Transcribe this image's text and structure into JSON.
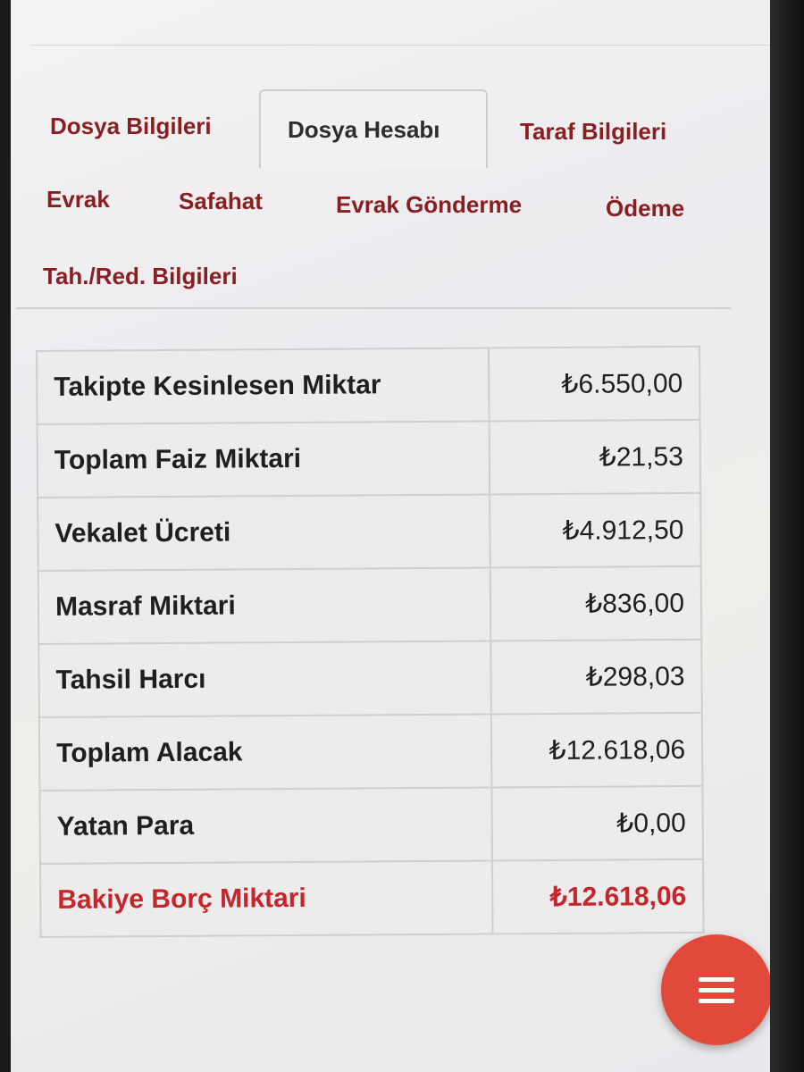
{
  "tabs": {
    "dosya_bilgileri": "Dosya Bilgileri",
    "dosya_hesabi": "Dosya Hesabı",
    "taraf_bilgileri": "Taraf Bilgileri",
    "evrak": "Evrak",
    "safahat": "Safahat",
    "evrak_gonderme": "Evrak Gönderme",
    "odeme": "Ödeme",
    "tah_red": "Tah./Red. Bilgileri",
    "active": "Dosya Hesabı"
  },
  "summary": {
    "rows": [
      {
        "label": "Takipte Kesinlesen Miktar",
        "value": "₺6.550,00"
      },
      {
        "label": "Toplam Faiz Miktari",
        "value": "₺21,53"
      },
      {
        "label": "Vekalet Ücreti",
        "value": "₺4.912,50"
      },
      {
        "label": "Masraf Miktari",
        "value": "₺836,00"
      },
      {
        "label": "Tahsil Harcı",
        "value": "₺298,03"
      },
      {
        "label": "Toplam Alacak",
        "value": "₺12.618,06"
      },
      {
        "label": "Yatan Para",
        "value": "₺0,00"
      },
      {
        "label": "Bakiye Borç Miktari",
        "value": "₺12.618,06"
      }
    ]
  },
  "fab": {
    "icon": "menu-icon"
  },
  "colors": {
    "accent": "#8a1f22",
    "total_red": "#c4262b",
    "fab": "#e14a3b"
  }
}
